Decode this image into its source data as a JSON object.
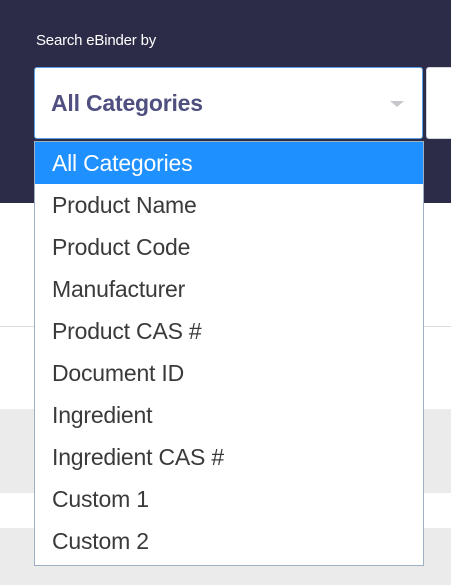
{
  "search": {
    "label": "Search eBinder by",
    "selected_value": "All Categories"
  },
  "dropdown": {
    "options": [
      {
        "label": "All Categories",
        "selected": true
      },
      {
        "label": "Product Name",
        "selected": false
      },
      {
        "label": "Product Code",
        "selected": false
      },
      {
        "label": "Manufacturer",
        "selected": false
      },
      {
        "label": "Product CAS #",
        "selected": false
      },
      {
        "label": "Document ID",
        "selected": false
      },
      {
        "label": "Ingredient",
        "selected": false
      },
      {
        "label": "Ingredient CAS #",
        "selected": false
      },
      {
        "label": "Custom 1",
        "selected": false
      },
      {
        "label": "Custom 2",
        "selected": false
      }
    ]
  },
  "colors": {
    "header_bg": "#2c2c48",
    "highlight": "#1e90ff",
    "selected_text": "#4f4f80"
  },
  "icons": {
    "select_chevron": "chevron-down-icon"
  }
}
